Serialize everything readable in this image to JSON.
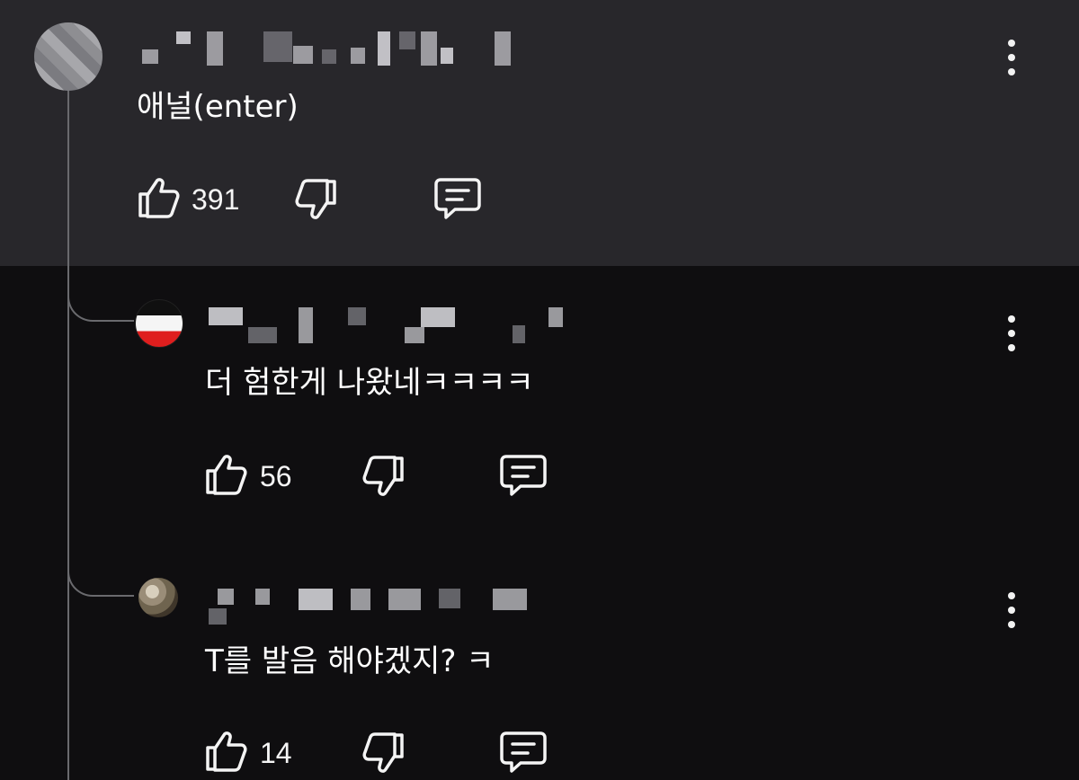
{
  "comments": [
    {
      "text": "애널(enter)",
      "like_count": "391"
    },
    {
      "text": "더 험한게 나왔네ㅋㅋㅋㅋ",
      "like_count": "56"
    },
    {
      "text": "T를 발음 해야겠지? ㅋ",
      "like_count": "14"
    }
  ],
  "icons": {
    "like": "thumb-up-icon",
    "dislike": "thumb-down-icon",
    "reply": "reply-icon",
    "more": "more-vert-icon"
  },
  "colors": {
    "top_comment_bg": "#28272b",
    "reply_bg": "#0f0e10",
    "thread_line": "#6a6a6e"
  }
}
